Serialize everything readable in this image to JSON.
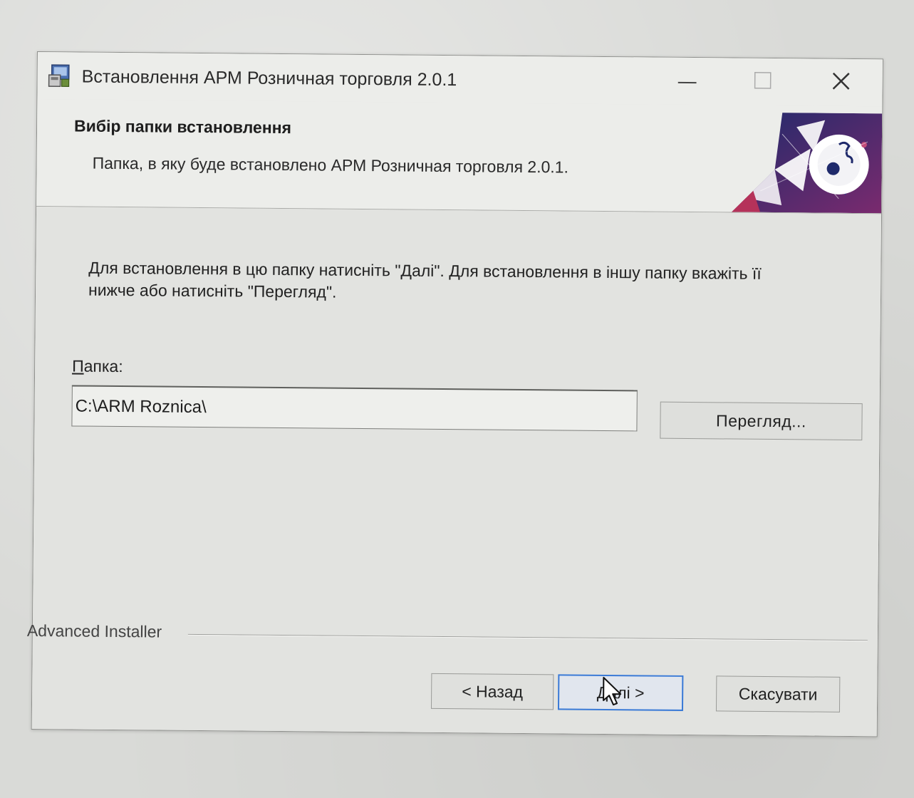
{
  "window": {
    "title": "Встановлення АРМ Розничная торговля 2.0.1",
    "minimize_icon": "minimize-icon",
    "maximize_icon": "maximize-icon",
    "close_icon": "close-icon"
  },
  "header": {
    "title": "Вибір папки встановлення",
    "subtitle": "Папка, в яку буде встановлено АРМ Розничная торговля 2.0.1."
  },
  "content": {
    "instructions": "Для встановлення в цю папку натисніть \"Далі\". Для встановлення в іншу папку вкажіть її нижче або натисніть \"Перегляд\".",
    "folder_label_accel": "П",
    "folder_label_rest": "апка:",
    "folder_value": "C:\\ARM Roznica\\",
    "browse_label": "Перегляд..."
  },
  "footer": {
    "brand": "Advanced Installer",
    "back_label": "< Назад",
    "next_label": "Далі >",
    "cancel_label": "Скасувати"
  },
  "colors": {
    "focus_border": "#3a7ad6",
    "banner_navy": "#1f2a6b",
    "banner_purple": "#7a2a6e"
  }
}
